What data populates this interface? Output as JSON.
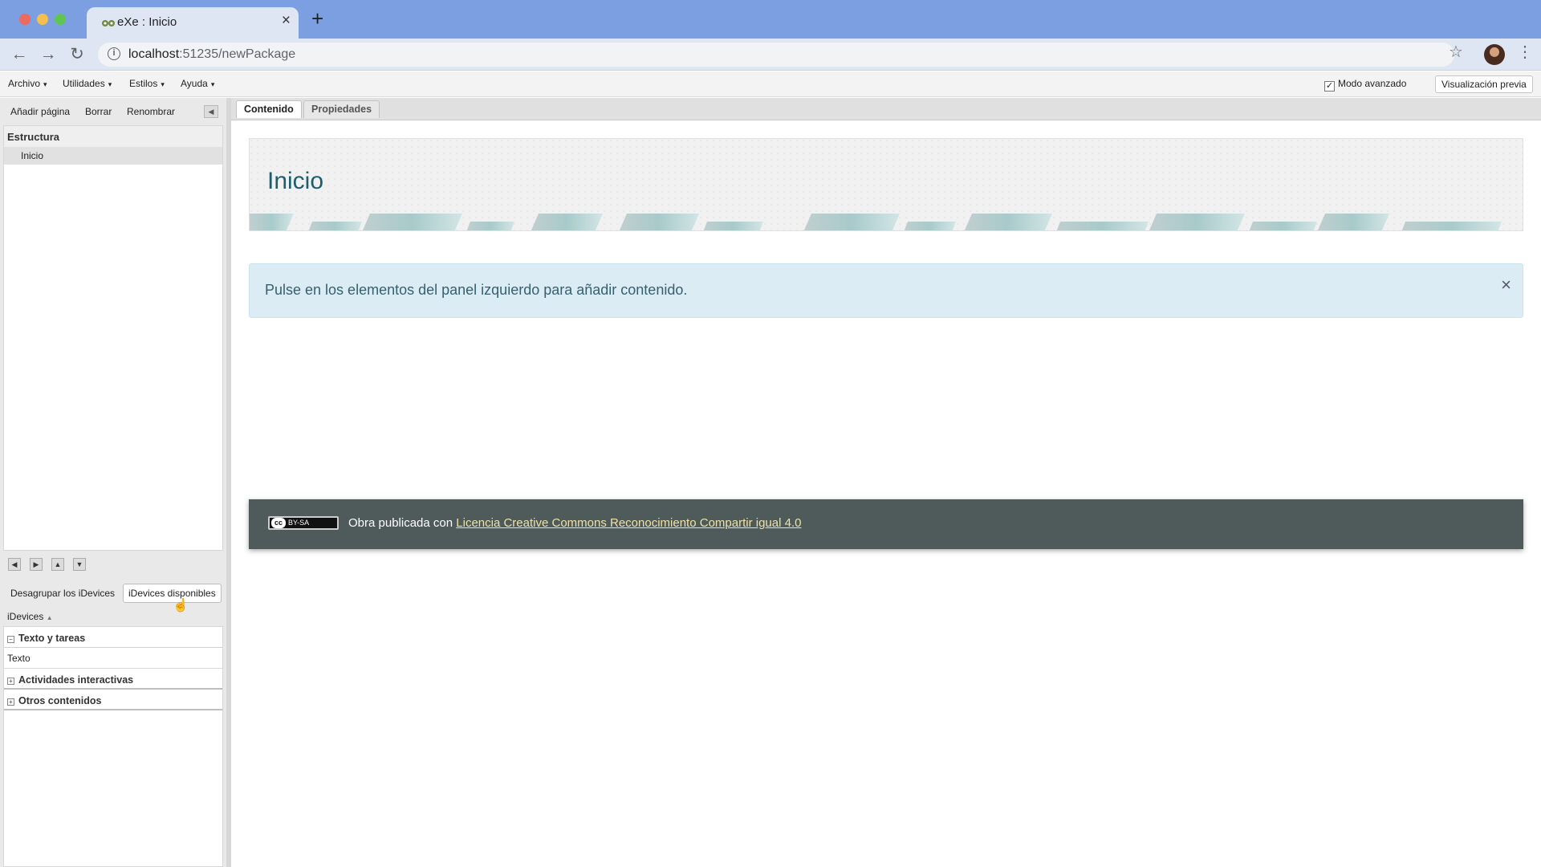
{
  "browser": {
    "tab_title": "eXe : Inicio",
    "url_host": "localhost",
    "url_rest": ":51235/newPackage"
  },
  "menubar": {
    "items": [
      "Archivo",
      "Utilidades",
      "Estilos",
      "Ayuda"
    ],
    "advanced_mode_label": "Modo avanzado",
    "advanced_mode_checked": true,
    "preview_button": "Visualización previa"
  },
  "left_panel": {
    "toolbar": [
      "Añadir página",
      "Borrar",
      "Renombrar"
    ],
    "structure_title": "Estructura",
    "tree_items": [
      "Inicio"
    ],
    "idevice_tabs": [
      "Desagrupar los iDevices",
      "iDevices disponibles"
    ],
    "idevices_header": "iDevices",
    "categories": [
      {
        "name": "Texto y tareas",
        "expanded": true,
        "children": [
          "Texto"
        ]
      },
      {
        "name": "Actividades interactivas",
        "expanded": false
      },
      {
        "name": "Otros contenidos",
        "expanded": false
      }
    ]
  },
  "content": {
    "tabs": [
      "Contenido",
      "Propiedades"
    ],
    "page_title": "Inicio",
    "alert_text": "Pulse en los elementos del panel izquierdo para añadir contenido.",
    "alert_close": "×",
    "footer_prefix": "Obra publicada con",
    "footer_link": "Licencia Creative Commons Reconocimiento Compartir igual 4.0",
    "license_badge": "BY-SA",
    "license_cc": "cc"
  },
  "colors": {
    "title_color": "#1e5d6e",
    "footer_bg": "#4e5b5a",
    "alert_bg": "#dbecf4",
    "link_color": "#f0e2a6"
  }
}
